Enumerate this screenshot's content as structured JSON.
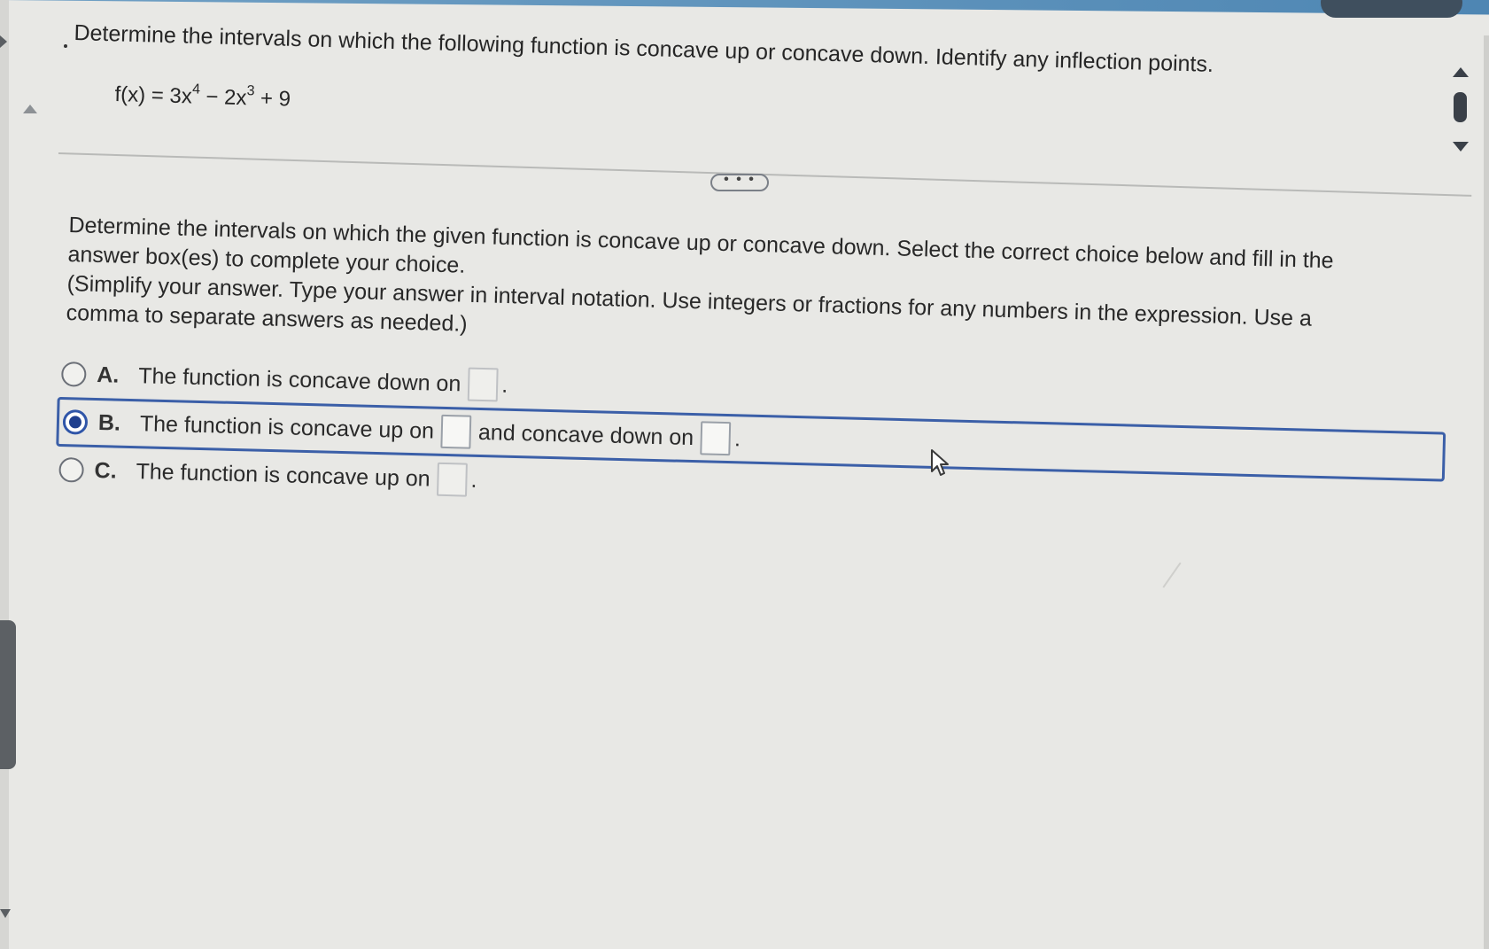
{
  "question": {
    "prompt": "Determine the intervals on which the following function is concave up or concave down. Identify any inflection points.",
    "function": {
      "lhs": "f(x) = 3x",
      "exp1": "4",
      "mid": " − 2x",
      "exp2": "3",
      "tail": " + 9"
    }
  },
  "expander": {
    "label": "• • •"
  },
  "instructions": {
    "line1": "Determine the intervals on which the given function is concave up or concave down. Select the correct choice below and fill in the",
    "line2": "answer box(es) to complete your choice.",
    "line3": "(Simplify your answer. Type your answer in interval notation. Use integers or fractions for any numbers in the expression. Use a",
    "line4": "comma to separate answers as needed.)"
  },
  "options": [
    {
      "letter": "A.",
      "text": "The function is concave down on",
      "selected": false
    },
    {
      "letter": "B.",
      "text1": "The function is concave up on",
      "text2": "and concave down on",
      "selected": true
    },
    {
      "letter": "C.",
      "text": "The function is concave up on",
      "selected": false
    }
  ],
  "punctuation": {
    "period": "."
  },
  "colors": {
    "selection_border": "#3b5fa8",
    "radio_selected": "#1f3f8e",
    "top_bar": "#5d92bb"
  }
}
